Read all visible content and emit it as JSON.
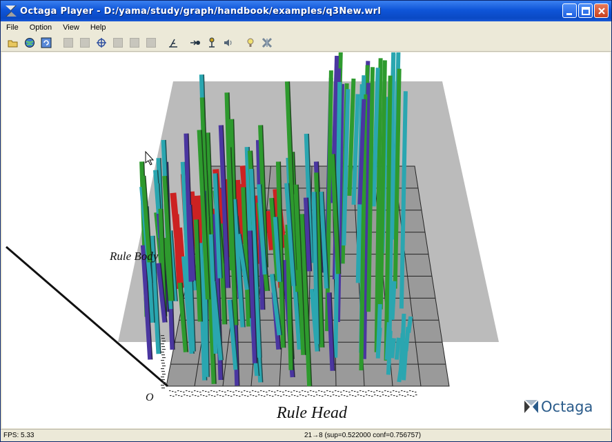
{
  "window": {
    "title": "Octaga Player - D:/yama/study/graph/handbook/examples/q3New.wrl"
  },
  "menu": {
    "items": [
      "File",
      "Option",
      "View",
      "Help"
    ]
  },
  "toolbar": {
    "icons": [
      "open-icon",
      "globe-icon",
      "refresh-icon",
      "walk-icon",
      "fly-icon",
      "examine-icon",
      "pan-icon",
      "zoom-icon",
      "slide-icon",
      "level-icon",
      "viewpoint-prev-icon",
      "headlight-icon",
      "sound-icon",
      "help-icon",
      "settings-icon"
    ]
  },
  "scene": {
    "axis_head_label": "Rule Head",
    "axis_body_label": "Rule Body",
    "origin_label": "O",
    "colors": {
      "red": "#cc2222",
      "green": "#2e9a2e",
      "cyan": "#2aa6b0",
      "purple": "#4a36a0",
      "plane": "#b4b4b4",
      "grid": "#8c8c8c"
    }
  },
  "logo": {
    "text": "Octaga"
  },
  "status": {
    "fps": "FPS: 5.33",
    "message": "21→8 (sup=0.522000 conf=0.756757)"
  }
}
